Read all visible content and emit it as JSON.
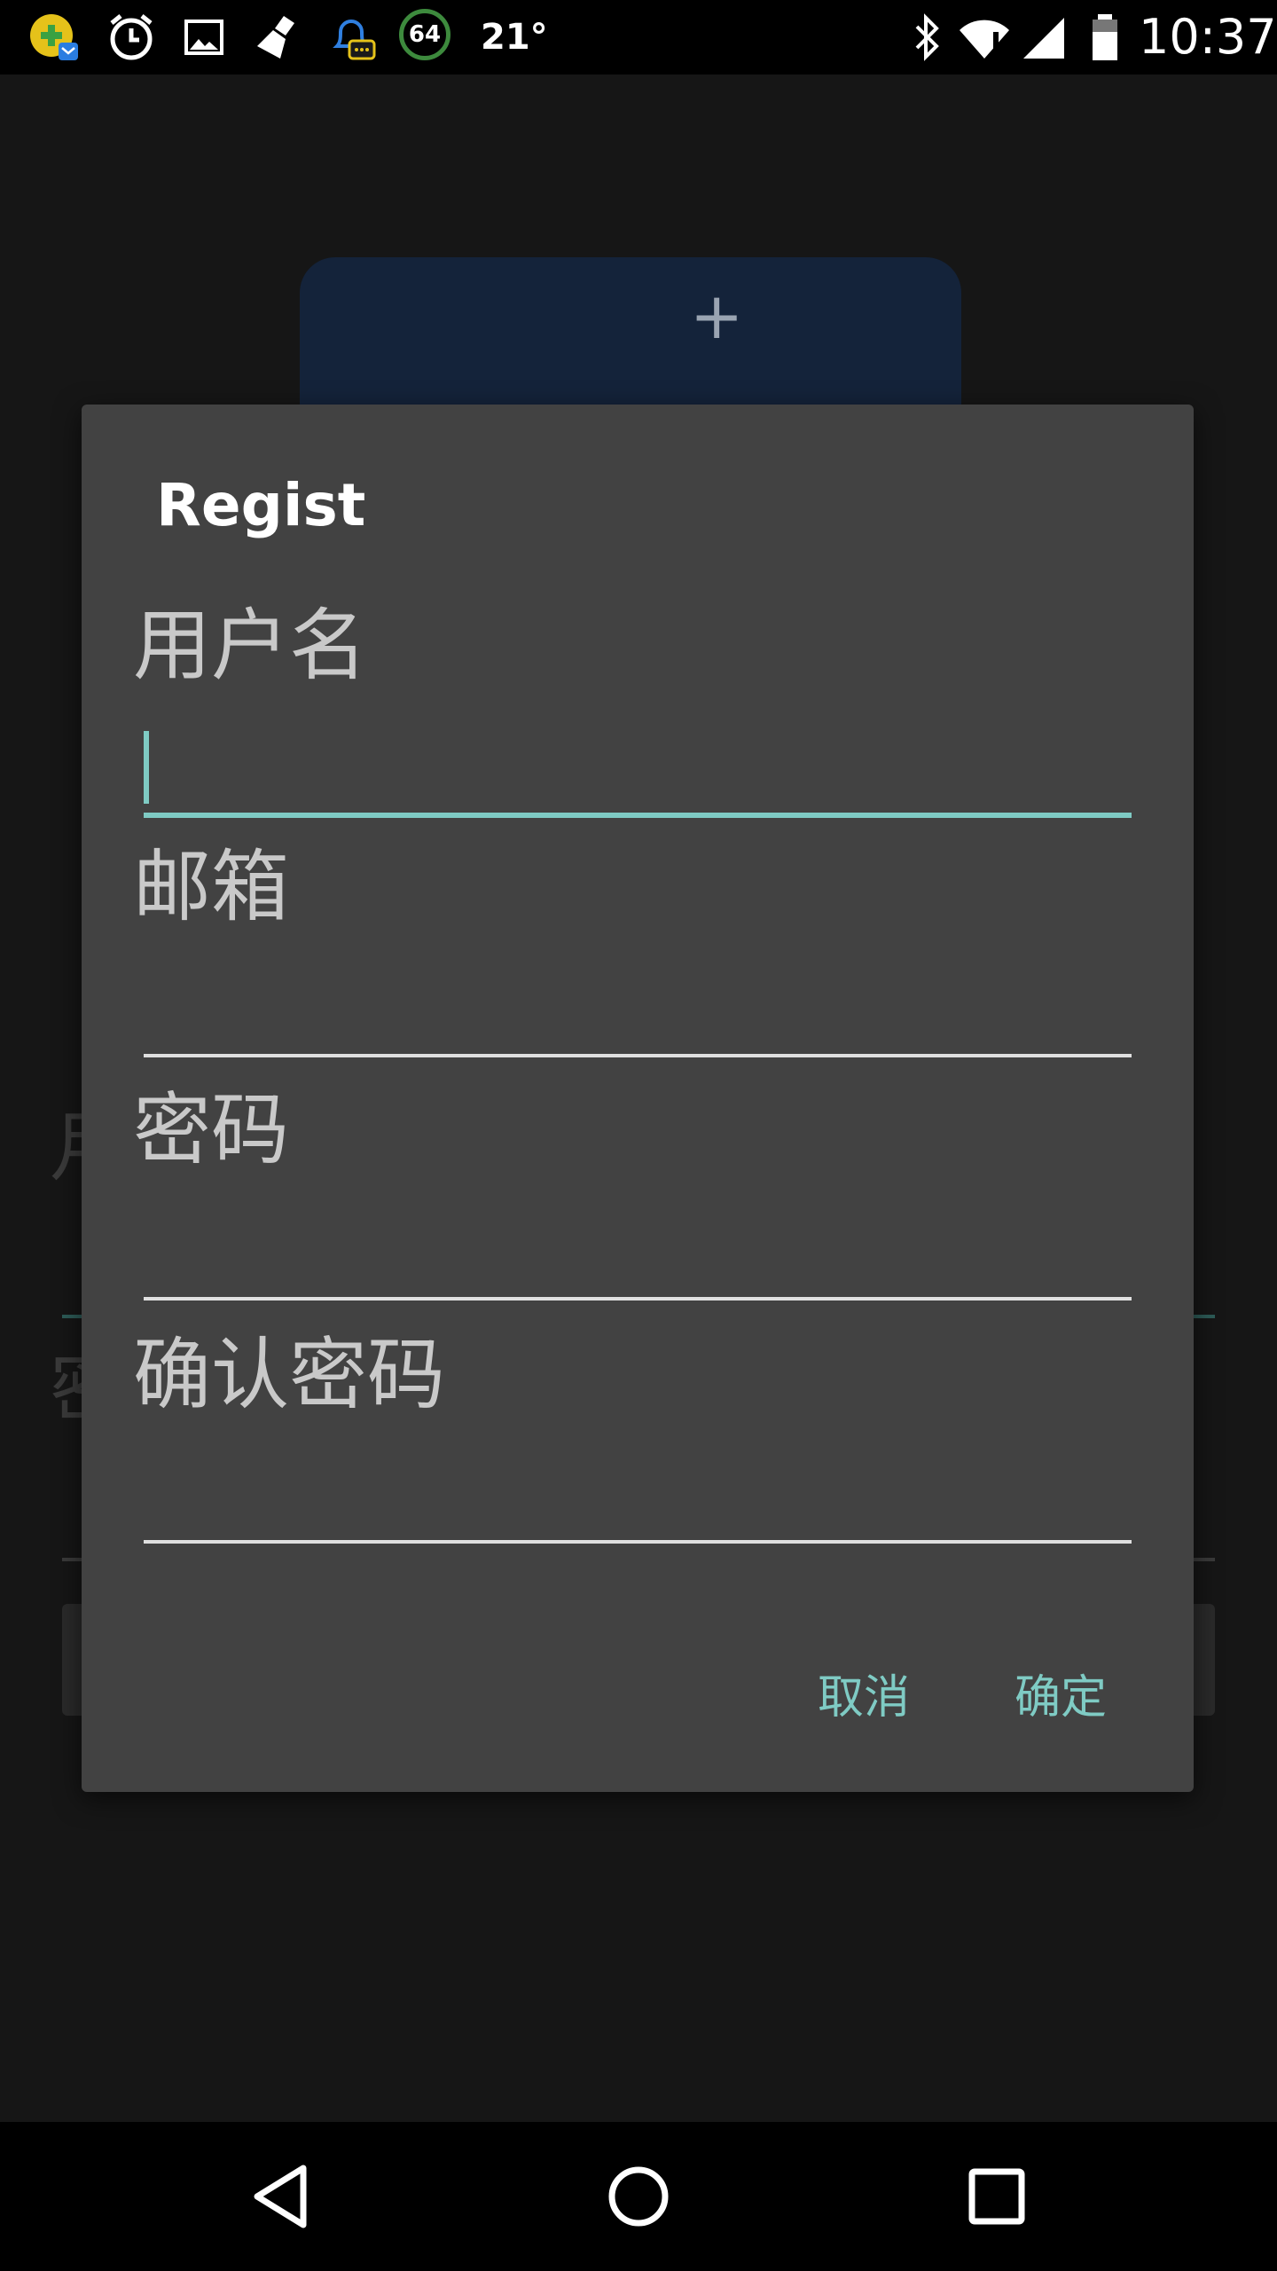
{
  "status_bar": {
    "temperature": "21°",
    "battery_circle_text": "64",
    "time": "10:37",
    "icons": [
      "app-badge-icon",
      "alarm-icon",
      "image-icon",
      "broom-icon",
      "notification-bell-icon",
      "battery-saver-icon",
      "bluetooth-icon",
      "wifi-icon",
      "signal-icon",
      "battery-icon"
    ]
  },
  "dialog": {
    "title": "Regist",
    "fields": [
      {
        "label": "用户名",
        "value": ""
      },
      {
        "label": "邮箱",
        "value": ""
      },
      {
        "label": "密码",
        "value": ""
      },
      {
        "label": "确认密码",
        "value": ""
      }
    ],
    "cancel_label": "取消",
    "confirm_label": "确定"
  },
  "background": {
    "fragment_1": "月",
    "fragment_2": "密"
  },
  "colors": {
    "accent": "#7fcbc4",
    "dialog_bg": "#424242"
  },
  "nav_bar": {
    "icons": [
      "back-icon",
      "home-icon",
      "recents-icon"
    ]
  }
}
